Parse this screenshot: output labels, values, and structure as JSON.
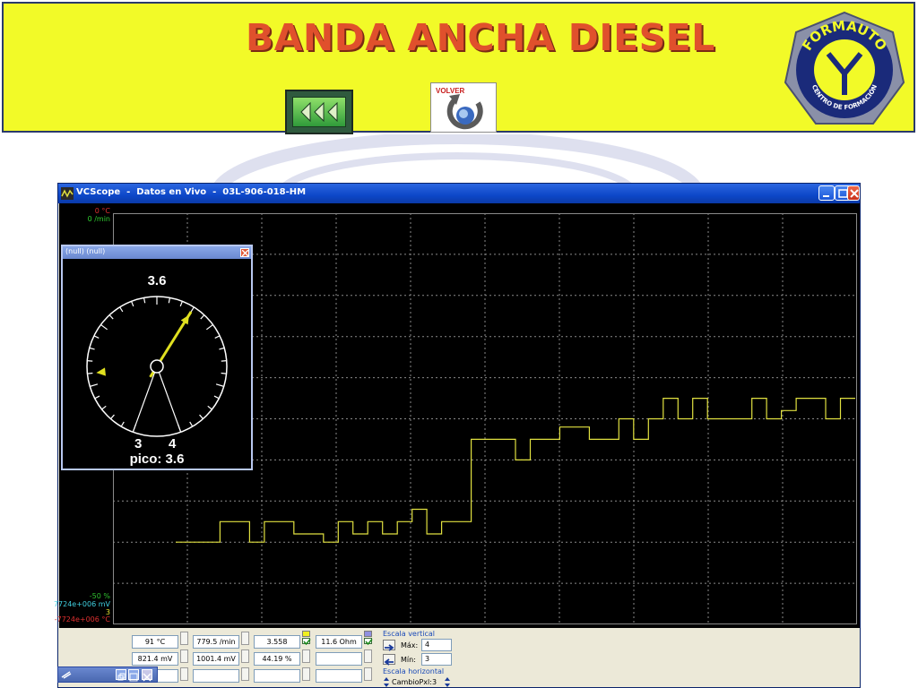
{
  "banner": {
    "title": "BANDA ANCHA DIESEL",
    "back_button_icon": "triple-left-arrow-icon",
    "volver_label": "VOLVER",
    "logo_top": "FORMAUTO",
    "logo_bottom": "CENTRO DE FORMACIÓN"
  },
  "window": {
    "title": "VCScope  -  Datos en Vivo  -  03L-906-018-HM",
    "buttons": [
      "minimize",
      "maximize",
      "close"
    ]
  },
  "scope": {
    "left_labels_top": [
      {
        "text": "0 °C",
        "color": "#e03030"
      },
      {
        "text": "0 /min",
        "color": "#30d030"
      }
    ],
    "left_labels_bottom": [
      {
        "text": "-50 %",
        "color": "#30c030"
      },
      {
        "text": "7724e+006 mV",
        "color": "#40d0e0"
      },
      {
        "text": "3",
        "color": "#e0e030"
      },
      {
        "text": "-7724e+006 °C",
        "color": "#e03030"
      }
    ],
    "trace_color": "#e0e040",
    "grid": true
  },
  "gauge": {
    "title": "(null) (null)",
    "value": "3.6",
    "min_label": "3",
    "max_label": "4",
    "peak_label": "pico: 3.6",
    "value_fraction": 0.6
  },
  "chart_data": {
    "type": "line",
    "series": [
      {
        "color": "#e0e040",
        "values": [
          3.2,
          3.2,
          3.2,
          3.25,
          3.25,
          3.2,
          3.25,
          3.25,
          3.22,
          3.22,
          3.2,
          3.25,
          3.22,
          3.25,
          3.22,
          3.25,
          3.28,
          3.22,
          3.25,
          3.25,
          3.45,
          3.45,
          3.45,
          3.4,
          3.45,
          3.45,
          3.48,
          3.48,
          3.45,
          3.45,
          3.5,
          3.45,
          3.5,
          3.55,
          3.5,
          3.55,
          3.5,
          3.5,
          3.5,
          3.55,
          3.5,
          3.52,
          3.55,
          3.55,
          3.5,
          3.55
        ]
      }
    ],
    "grid": true
  },
  "panel": {
    "fields": [
      [
        "91 °C",
        "779.5 /min",
        "3.558",
        "11.6 Ohm"
      ],
      [
        "821.4 mV",
        "1001.4 mV",
        "44.19 %",
        ""
      ],
      [
        "",
        "",
        "",
        ""
      ]
    ],
    "swatch_colors": [
      "#f0f020",
      "#9090e0"
    ],
    "escala_vertical": {
      "label": "Escala vertical",
      "max_label": "Máx:",
      "max_value": "4",
      "min_label": "Mín:",
      "min_value": "3"
    },
    "escala_horizontal": {
      "label": "Escala horizontal",
      "value": "CambioPxl:3"
    }
  }
}
